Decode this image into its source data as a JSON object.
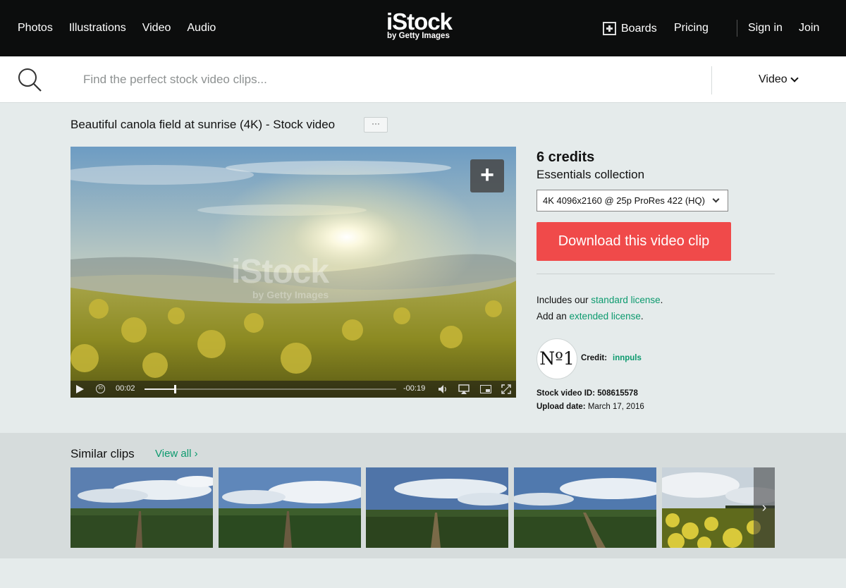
{
  "nav": {
    "left": [
      "Photos",
      "Illustrations",
      "Video",
      "Audio"
    ],
    "logo": "iStock",
    "logo_sub": "by Getty Images",
    "boards": "Boards",
    "pricing": "Pricing",
    "signin": "Sign in",
    "join": "Join"
  },
  "search": {
    "placeholder": "Find the perfect stock video clips...",
    "type": "Video"
  },
  "asset": {
    "title": "Beautiful canola field at sunrise (4K) - Stock video",
    "more": "···",
    "watermark": "iStock",
    "watermark_sub": "by Getty Images"
  },
  "player": {
    "current_time": "00:02",
    "remaining_time": "-00:19",
    "progress_fraction": 0.12
  },
  "purchase": {
    "credits": "6 credits",
    "collection": "Essentials collection",
    "format": "4K 4096x2160 @ 25p ProRes 422 (HQ)",
    "download": "Download this video clip",
    "license_pre": "Includes our ",
    "license_link": "standard license",
    "license_post": ".",
    "ext_pre": "Add an ",
    "ext_link": "extended license",
    "ext_post": "."
  },
  "contributor": {
    "badge": "Nº1",
    "credit_label": "Credit:",
    "credit_name": "innpuls"
  },
  "meta": {
    "id_label": "Stock video ID:",
    "id_value": "508615578",
    "date_label": "Upload date:",
    "date_value": "March 17, 2016"
  },
  "similar": {
    "title": "Similar clips",
    "view_all": "View all ›",
    "next": "›"
  },
  "colors": {
    "accent_green": "#0c9a6e",
    "download_red": "#f04a4a",
    "topbar": "#0c0d0d"
  }
}
